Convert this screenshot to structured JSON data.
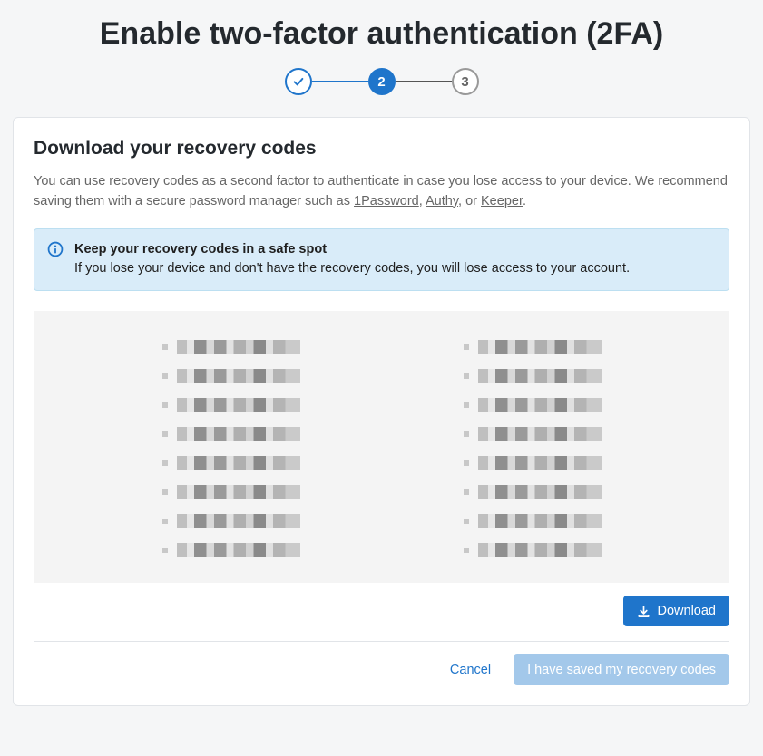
{
  "page": {
    "title": "Enable two-factor authentication (2FA)"
  },
  "stepper": {
    "steps": [
      {
        "state": "done",
        "label": ""
      },
      {
        "state": "active",
        "label": "2"
      },
      {
        "state": "inactive",
        "label": "3"
      }
    ]
  },
  "section": {
    "title": "Download your recovery codes",
    "desc_before": "You can use recovery codes as a second factor to authenticate in case you lose access to your device. We recommend saving them with a secure password manager such as ",
    "link1": "1Password",
    "sep1": ", ",
    "link2": "Authy",
    "sep2": ", or ",
    "link3": "Keeper",
    "desc_after": "."
  },
  "alert": {
    "icon": "info-icon",
    "title": "Keep your recovery codes in a safe spot",
    "body": "If you lose your device and don't have the recovery codes, you will lose access to your account."
  },
  "recovery_codes": {
    "note": "Codes are obscured in the source image",
    "left_count": 8,
    "right_count": 8
  },
  "buttons": {
    "download": "Download",
    "cancel": "Cancel",
    "saved": "I have saved my recovery codes"
  }
}
